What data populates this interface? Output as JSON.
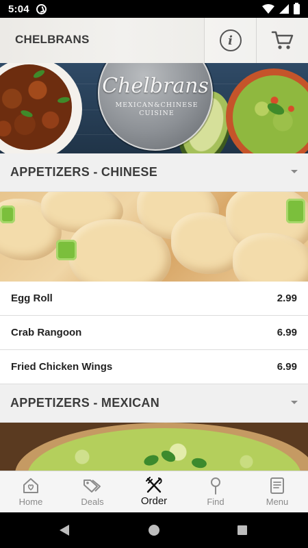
{
  "status_bar": {
    "time": "5:04"
  },
  "header": {
    "brand": "CHELBRANS",
    "info_icon": "info-icon",
    "cart_icon": "cart-icon"
  },
  "banner": {
    "logo_script": "Chelbrans",
    "logo_line1": "MEXICAN&CHINESE",
    "logo_line2": "CUISINE"
  },
  "sections": [
    {
      "title": "APPETIZERS - CHINESE",
      "items": [
        {
          "name": "Egg Roll",
          "price": "2.99"
        },
        {
          "name": "Crab Rangoon",
          "price": "6.99"
        },
        {
          "name": "Fried Chicken Wings",
          "price": "6.99"
        }
      ]
    },
    {
      "title": "APPETIZERS - MEXICAN",
      "items": []
    }
  ],
  "bottom_nav": [
    {
      "label": "Home",
      "icon": "home-icon",
      "active": false
    },
    {
      "label": "Deals",
      "icon": "tag-icon",
      "active": false
    },
    {
      "label": "Order",
      "icon": "utensils-icon",
      "active": true
    },
    {
      "label": "Find",
      "icon": "location-pin-icon",
      "active": false
    },
    {
      "label": "Menu",
      "icon": "book-icon",
      "active": false
    }
  ],
  "colors": {
    "status_bar": "#000000",
    "section_header_bg": "#f0f0f0",
    "nav_active": "#111111",
    "nav_inactive": "#8a8a8a"
  }
}
